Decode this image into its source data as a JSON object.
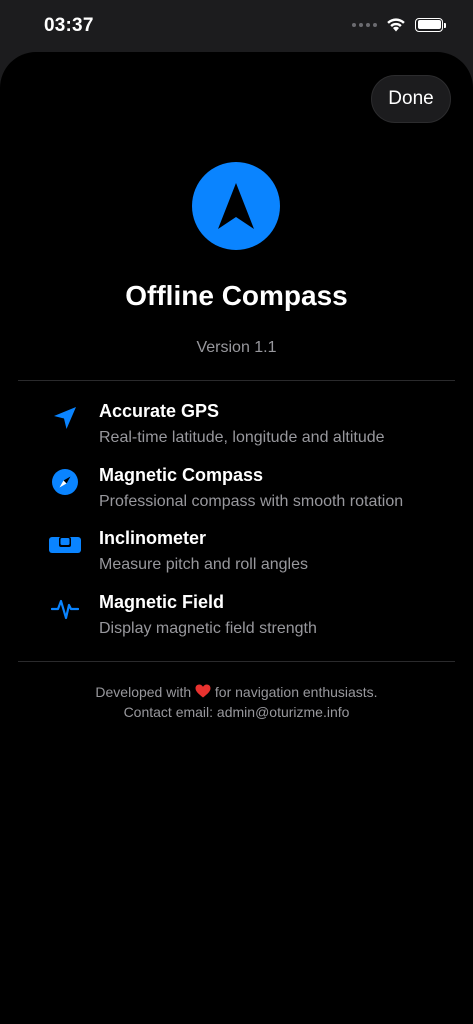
{
  "status_bar": {
    "time": "03:37"
  },
  "header": {
    "done_label": "Done"
  },
  "app": {
    "title": "Offline Compass",
    "version": "Version 1.1",
    "accent": "#0a84ff"
  },
  "features": [
    {
      "icon": "location-arrow-icon",
      "title": "Accurate GPS",
      "desc": "Real-time latitude, longitude and altitude"
    },
    {
      "icon": "compass-icon",
      "title": "Magnetic Compass",
      "desc": "Professional compass with smooth rotation"
    },
    {
      "icon": "level-icon",
      "title": "Inclinometer",
      "desc": "Measure pitch and roll angles"
    },
    {
      "icon": "waveform-icon",
      "title": "Magnetic Field",
      "desc": "Display magnetic field strength"
    }
  ],
  "footer": {
    "line1_before": "Developed with ",
    "line1_after": " for navigation enthusiasts.",
    "line2": "Contact email: admin@oturizme.info"
  }
}
